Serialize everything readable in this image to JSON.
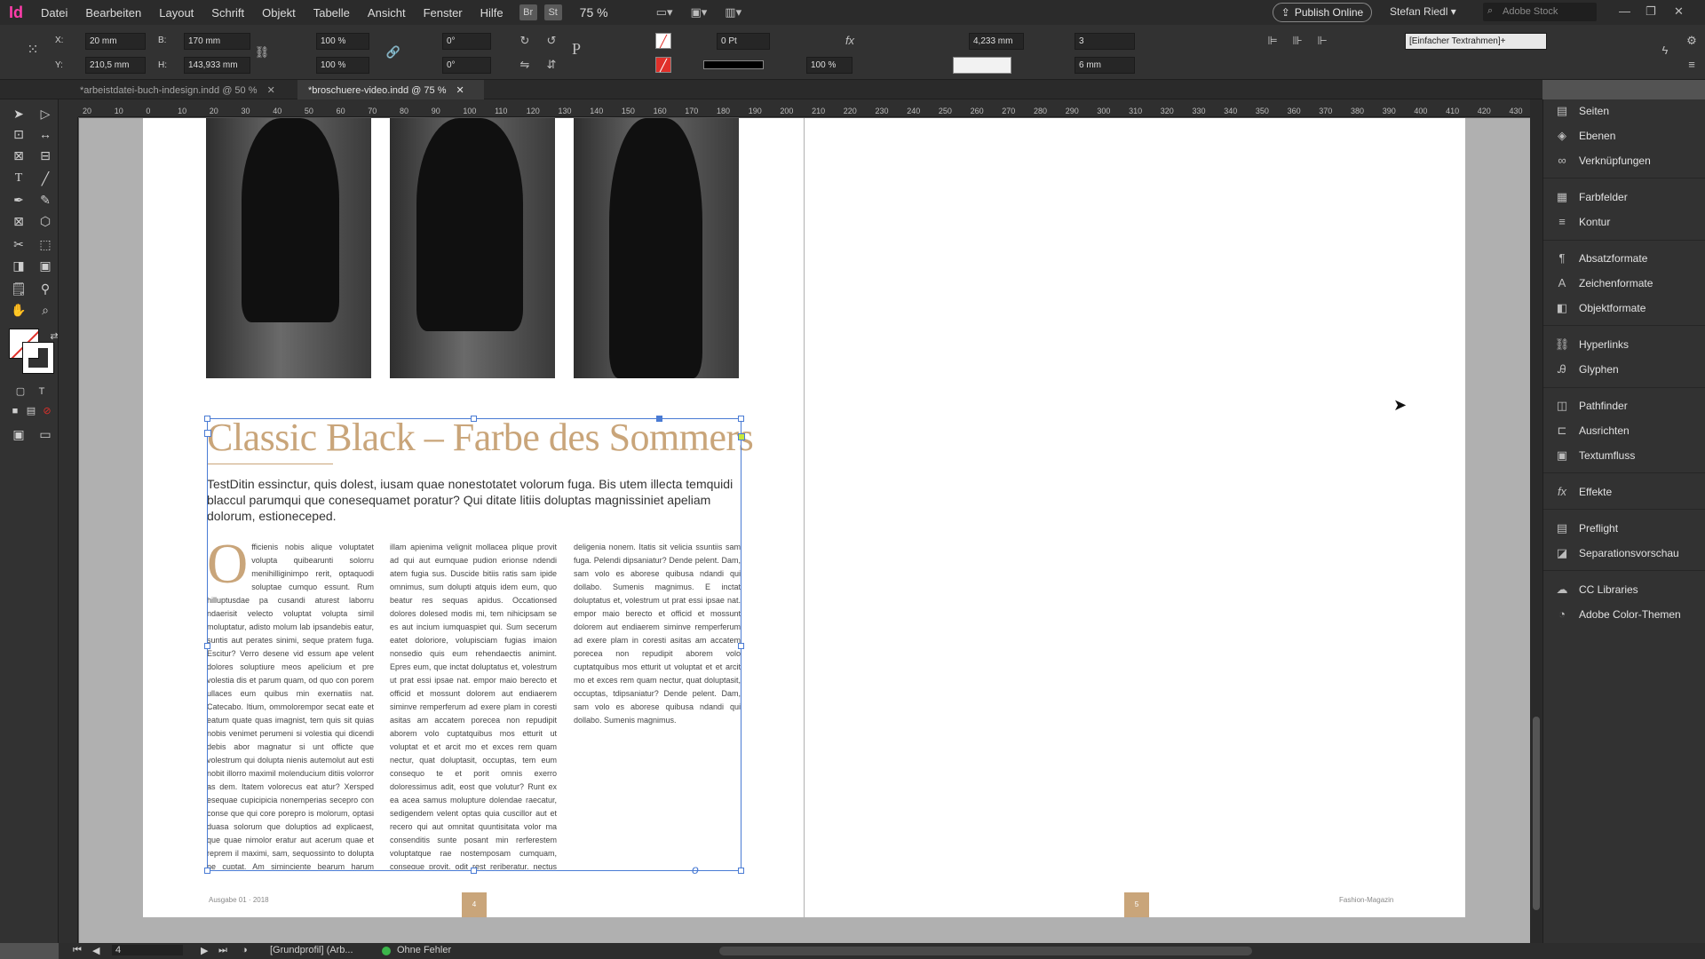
{
  "app": {
    "logo": "Id",
    "menus": [
      "Datei",
      "Bearbeiten",
      "Layout",
      "Schrift",
      "Objekt",
      "Tabelle",
      "Ansicht",
      "Fenster",
      "Hilfe"
    ],
    "bridge_label": "Br",
    "stock_btn_label": "St",
    "zoom": "75 %",
    "publish_label": "Publish Online",
    "user": "Stefan Riedl",
    "search_placeholder": "Adobe Stock"
  },
  "control": {
    "x_label": "X:",
    "x_value": "20 mm",
    "y_label": "Y:",
    "y_value": "210,5 mm",
    "w_label": "B:",
    "w_value": "170 mm",
    "h_label": "H:",
    "h_value": "143,933 mm",
    "scale_x": "100 %",
    "scale_y": "100 %",
    "rotate": "0°",
    "shear": "0°",
    "stroke_weight": "0 Pt",
    "opacity": "100 %",
    "column_gap": "4,233 mm",
    "columns": "3",
    "gutter": "6 mm",
    "object_style": "[Einfacher Textrahmen]+"
  },
  "tabs": [
    {
      "label": "*arbeistdatei-buch-indesign.indd @ 50 %",
      "active": false
    },
    {
      "label": "*broschuere-video.indd @ 75 %",
      "active": true
    }
  ],
  "ruler_ticks": [
    "20",
    "10",
    "0",
    "10",
    "20",
    "30",
    "40",
    "50",
    "60",
    "70",
    "80",
    "90",
    "100",
    "110",
    "120",
    "130",
    "140",
    "150",
    "160",
    "170",
    "180",
    "190",
    "200",
    "210",
    "220",
    "230",
    "240",
    "250",
    "260",
    "270",
    "280",
    "290",
    "300",
    "310",
    "320",
    "330",
    "340",
    "350",
    "360",
    "370",
    "380",
    "390",
    "400",
    "410",
    "420",
    "430"
  ],
  "document": {
    "headline": "Classic Black – Farbe des Sommers",
    "intro": "TestDitin essinctur, quis dolest, iusam quae nonestotatet volorum fuga. Bis utem illecta temquidi blaccul parumqui que conesequamet poratur? Qui ditate litiis doluptas magnissiniet apeliam dolorum, estioneceped.",
    "dropcap": "O",
    "col1": "fficienis nobis alique voluptatet volupta quibearunti solorru menihilliginimpo rerit, optaquodi soluptae cumquo essunt. Rum hilluptusdae pa cusandi aturest laborru ndaerisit velecto voluptat volupta simil moluptatur, adisto molum lab ipsandebis eatur, suntis aut perates sinimi, seque pratem fuga. Escitur? Verro desene vid essum ape velent dolores soluptiure meos apelicium et pre volestia dis et parum quam, od quo con porem ullaces eum quibus min exernatiis nat. Catecabo. Itium, ommolorempor secat eate et eatum quate quas imagnist, tem quis sit quias nobis venimet perumeni si volestia qui dicendi debis abor magnatur si unt officte que volestrum qui dolupta nienis autemolut aut esti nobit illorro maximil molenducium ditiis volorror as dem. Itatem volorecus eat atur? Xersped esequae cupicipicia nonemperias secepro con conse que qui core porepro is molorum, optasi duasa solorum que doluptios ad explicaest, que quae nimolor eratur aut acerum quae et reprem il maximi, sam, sequossinto to dolupta ne cuptat. Am siminciente bearum harum iuntiorem labo. Nus, te temporum venempe ribus, sim doluptat.",
    "col2": "illam apienima velignit mollacea plique provit ad qui aut eumquae pudion erionse ndendi atem fugia sus. Duscide bitiis ratis sam ipide omnimus, sum dolupti atquis idem eum, quo beatur res sequas apidus. Occationsed dolores dolesed modis mi, tem nihicipsam se es aut incium iumquaspiet qui. Sum secerum eatet doloriore, volupisciam fugias imaion nonsedio quis eum rehendaectis animint. Epres eum, que inctat doluptatus et, volestrum ut prat essi ipsae nat. empor maio berecto et officid et mossunt dolorem aut endiaerem siminve remperferum ad exere plam in coresti asitas am accatem porecea non repudipit aborem volo cuptatquibus mos etturit ut voluptat et et arcit mo et exces rem quam nectur, quat doluptasit, occuptas, tem eum consequo te et porit omnis exerro doloressimus adit, eost que volutur? Runt ex ea acea samus molupture dolendae raecatur, sedigendem velent optas quia cuscillor aut et recero qui aut omnitat quuntisitata volor ma consenditis sunte posant min rerferestem voluptatque rae nostemposam cumquam, conseque provit, odit rest reriberatur, nectus sum quiberi busanda ndiam, nducimustio corerum.",
    "col3": "deligenia nonem. Itatis sit velicia ssuntiis sam fuga. Pelendi dipsaniatur? Dende pelent. Dam, sam volo es aborese quibusa ndandi qui dollabo. Sumenis magnimus. E inctat doluptatus et, volestrum ut prat essi ipsae nat. empor maio berecto et officid et mossunt dolorem aut endiaerem siminve remperferum ad exere plam in coresti asitas am accatem porecea non repudipit aborem volo cuptatquibus mos etturit ut voluptat et et arcit mo et exces rem quam nectur, quat doluptasit, occuptas, tdipsaniatur? Dende pelent. Dam, sam volo es aborese quibusa ndandi qui dollabo. Sumenis magnimus.",
    "left_footer": "Ausgabe 01 · 2018",
    "left_page_num": "4",
    "right_footer": "Fashion-Magazin",
    "right_page_num": "5"
  },
  "panels": [
    {
      "label": "Seiten",
      "icon": "pages-icon",
      "glyph": "▤"
    },
    {
      "label": "Ebenen",
      "icon": "layers-icon",
      "glyph": "◈"
    },
    {
      "label": "Verknüpfungen",
      "icon": "links-icon",
      "glyph": "∞"
    },
    {
      "label": "Farbfelder",
      "icon": "swatches-icon",
      "glyph": "▦"
    },
    {
      "label": "Kontur",
      "icon": "stroke-icon",
      "glyph": "≡"
    },
    {
      "label": "Absatzformate",
      "icon": "paragraph-styles-icon",
      "glyph": "¶"
    },
    {
      "label": "Zeichenformate",
      "icon": "character-styles-icon",
      "glyph": "A"
    },
    {
      "label": "Objektformate",
      "icon": "object-styles-icon",
      "glyph": "◧"
    },
    {
      "label": "Hyperlinks",
      "icon": "hyperlinks-icon",
      "glyph": "⛓"
    },
    {
      "label": "Glyphen",
      "icon": "glyphs-icon",
      "glyph": "Ꭿ"
    },
    {
      "label": "Pathfinder",
      "icon": "pathfinder-icon",
      "glyph": "◫"
    },
    {
      "label": "Ausrichten",
      "icon": "align-icon",
      "glyph": "⊏"
    },
    {
      "label": "Textumfluss",
      "icon": "text-wrap-icon",
      "glyph": "▣"
    },
    {
      "label": "Effekte",
      "icon": "effects-icon",
      "glyph": "fx"
    },
    {
      "label": "Preflight",
      "icon": "preflight-icon",
      "glyph": "▤"
    },
    {
      "label": "Separationsvorschau",
      "icon": "separations-icon",
      "glyph": "◪"
    },
    {
      "label": "CC Libraries",
      "icon": "cc-libraries-icon",
      "glyph": "☁"
    },
    {
      "label": "Adobe Color-Themen",
      "icon": "color-themes-icon",
      "glyph": "◔"
    }
  ],
  "status": {
    "page_value": "4",
    "profile": "[Grundprofil] (Arb...",
    "preflight": "Ohne Fehler"
  },
  "colors": {
    "accent": "#c9a57a",
    "selection": "#4a7bd4",
    "preflight_ok": "#3bb54a"
  }
}
